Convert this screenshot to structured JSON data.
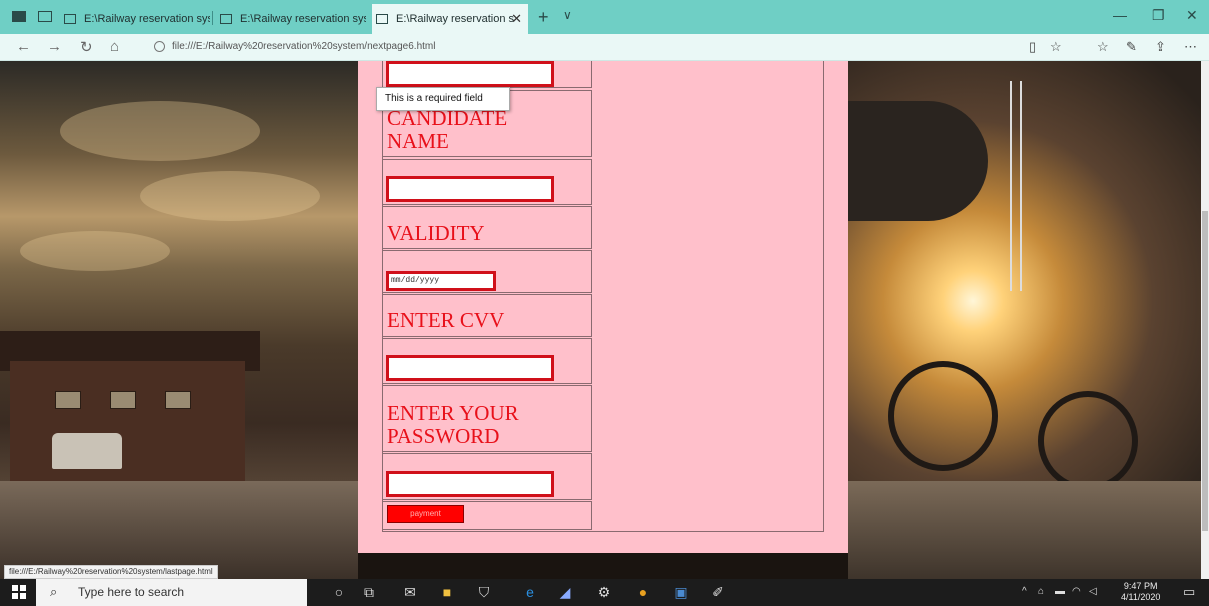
{
  "browser": {
    "tabs": [
      {
        "label": "E:\\Railway reservation syste",
        "active": false
      },
      {
        "label": "E:\\Railway reservation syste",
        "active": false
      },
      {
        "label": "E:\\Railway reservation s",
        "active": true
      }
    ],
    "new_tab": "+",
    "tab_menu": "∨",
    "url": "file:///E:/Railway%20reservation%20system/nextpage6.html",
    "window_controls": {
      "minimize": "—",
      "restore": "❐",
      "close": "✕"
    }
  },
  "form": {
    "tooltip": "This is a required field",
    "candidate_name_label": "CANDIDATE NAME",
    "validity_label": "VALIDITY",
    "date_placeholder": "mm/dd/yyyy",
    "cvv_label": "ENTER CVV",
    "password_label": "ENTER YOUR PASSWORD",
    "payment_button": "payment"
  },
  "status_bar": "file:///E:/Railway%20reservation%20system/lastpage.html",
  "taskbar": {
    "search_placeholder": "Type here to search",
    "time": "9:47 PM",
    "date": "4/11/2020"
  },
  "colors": {
    "panel_bg": "#ffc0cb",
    "label": "#e8101a",
    "input_border": "#d0101a",
    "button": "#ff0000",
    "tabbar": "#6fcfc5"
  }
}
